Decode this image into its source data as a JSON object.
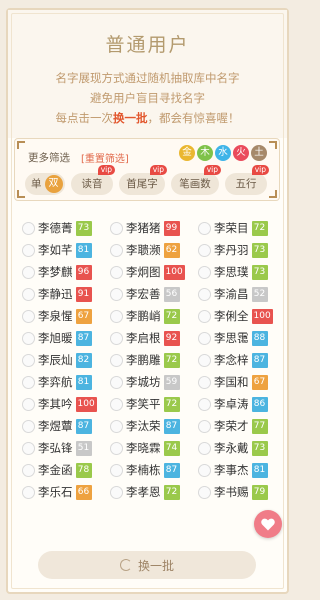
{
  "title": "普通用户",
  "intro": {
    "line1": "名字展现方式通过随机抽取库中名字",
    "line2": "避免用户盲目寻找名字",
    "line3_pre": "每点击一次",
    "line3_hl": "换一批",
    "line3_post": "，都会有惊喜喔！"
  },
  "filter": {
    "more_label": "更多筛选",
    "reset_label": "[重置筛选]",
    "elements": [
      {
        "label": "金",
        "color": "#eab730"
      },
      {
        "label": "木",
        "color": "#7fc24a"
      },
      {
        "label": "水",
        "color": "#3fb4e8"
      },
      {
        "label": "火",
        "color": "#ea4b5c"
      },
      {
        "label": "土",
        "color": "#a6896a"
      }
    ],
    "single_label": "单",
    "dual_label": "双",
    "options": [
      {
        "label": "读音",
        "vip": "vip"
      },
      {
        "label": "首尾字",
        "vip": "vip"
      },
      {
        "label": "笔画数",
        "vip": "vip"
      },
      {
        "label": "五行",
        "vip": "vip"
      }
    ]
  },
  "names": [
    {
      "name": "李德菁",
      "score": "73",
      "color": "#9ac94b"
    },
    {
      "name": "李猪猪",
      "score": "99",
      "color": "#e8534f"
    },
    {
      "name": "李荣目",
      "score": "72",
      "color": "#9ac94b"
    },
    {
      "name": "李如芊",
      "score": "81",
      "color": "#4cb4e0"
    },
    {
      "name": "李聩濒",
      "score": "62",
      "color": "#eea240"
    },
    {
      "name": "李丹羽",
      "score": "73",
      "color": "#9ac94b"
    },
    {
      "name": "李梦麒",
      "score": "96",
      "color": "#e8534f"
    },
    {
      "name": "李炯图",
      "score": "100",
      "color": "#e8534f"
    },
    {
      "name": "李思璞",
      "score": "73",
      "color": "#9ac94b"
    },
    {
      "name": "李静迅",
      "score": "91",
      "color": "#e8534f"
    },
    {
      "name": "李宏善",
      "score": "56",
      "color": "#c8c8c8"
    },
    {
      "name": "李渝昌",
      "score": "52",
      "color": "#c8c8c8"
    },
    {
      "name": "李泉惺",
      "score": "67",
      "color": "#eea240"
    },
    {
      "name": "李鹏峭",
      "score": "72",
      "color": "#9ac94b"
    },
    {
      "name": "李俐全",
      "score": "100",
      "color": "#e8534f"
    },
    {
      "name": "李旭暖",
      "score": "87",
      "color": "#4cb4e0"
    },
    {
      "name": "李启根",
      "score": "92",
      "color": "#e8534f"
    },
    {
      "name": "李思霭",
      "score": "88",
      "color": "#4cb4e0"
    },
    {
      "name": "李辰灿",
      "score": "82",
      "color": "#4cb4e0"
    },
    {
      "name": "李鹏雕",
      "score": "72",
      "color": "#9ac94b"
    },
    {
      "name": "李念梓",
      "score": "87",
      "color": "#4cb4e0"
    },
    {
      "name": "李弈航",
      "score": "81",
      "color": "#4cb4e0"
    },
    {
      "name": "李城坊",
      "score": "59",
      "color": "#c8c8c8"
    },
    {
      "name": "李国和",
      "score": "67",
      "color": "#eea240"
    },
    {
      "name": "李其吟",
      "score": "100",
      "color": "#e8534f"
    },
    {
      "name": "李笑平",
      "score": "72",
      "color": "#9ac94b"
    },
    {
      "name": "李卓涛",
      "score": "86",
      "color": "#4cb4e0"
    },
    {
      "name": "李煜蕈",
      "score": "87",
      "color": "#4cb4e0"
    },
    {
      "name": "李汰荣",
      "score": "87",
      "color": "#4cb4e0"
    },
    {
      "name": "李荣才",
      "score": "77",
      "color": "#9ac94b"
    },
    {
      "name": "李弘锋",
      "score": "51",
      "color": "#c8c8c8"
    },
    {
      "name": "李晓霖",
      "score": "74",
      "color": "#9ac94b"
    },
    {
      "name": "李永戴",
      "score": "73",
      "color": "#9ac94b"
    },
    {
      "name": "李金函",
      "score": "78",
      "color": "#9ac94b"
    },
    {
      "name": "李楠栋",
      "score": "87",
      "color": "#4cb4e0"
    },
    {
      "name": "李事杰",
      "score": "81",
      "color": "#4cb4e0"
    },
    {
      "name": "李乐石",
      "score": "66",
      "color": "#eea240"
    },
    {
      "name": "李孝恩",
      "score": "72",
      "color": "#9ac94b"
    },
    {
      "name": "李书赐",
      "score": "79",
      "color": "#9ac94b"
    }
  ],
  "refresh_label": "换一批",
  "colors": {
    "accent": "#e2572e",
    "gold": "#b39a6e"
  }
}
